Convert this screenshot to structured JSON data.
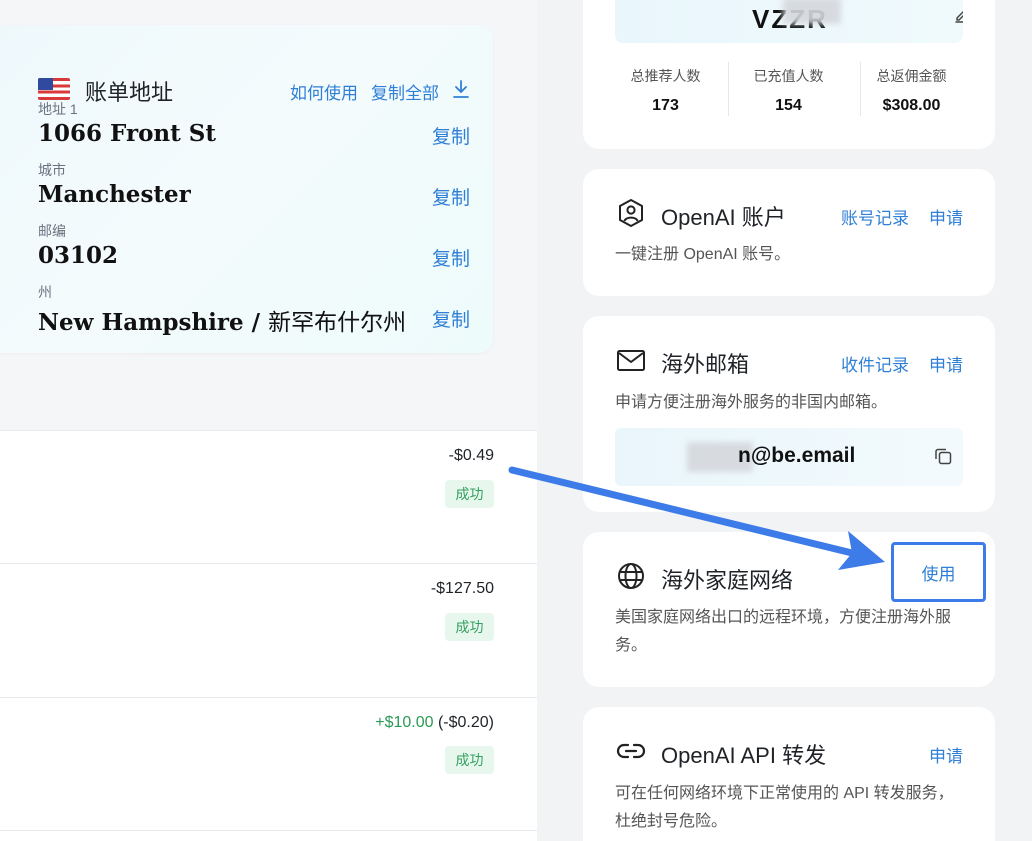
{
  "billing": {
    "title": "账单地址",
    "how_to_use": "如何使用",
    "copy_all": "复制全部",
    "copy_label": "复制",
    "fields": [
      {
        "label": "地址 1",
        "value": "1066 Front St"
      },
      {
        "label": "城市",
        "value": "Manchester"
      },
      {
        "label": "邮编",
        "value": "03102"
      },
      {
        "label": "州",
        "value": "New Hampshire / ",
        "value_cn": "新罕布什尔州"
      }
    ]
  },
  "transactions": [
    {
      "amount": "-$0.49",
      "status": "成功"
    },
    {
      "amount": "-$127.50",
      "status": "成功"
    },
    {
      "amount_positive": "+$10.00",
      "amount_fee": " (-$0.20)",
      "status": "成功"
    }
  ],
  "referral": {
    "banner_code": "VZZR",
    "stats": [
      {
        "label": "总推荐人数",
        "value": "173"
      },
      {
        "label": "已充值人数",
        "value": "154"
      },
      {
        "label": "总返佣金额",
        "value": "$308.00"
      }
    ]
  },
  "services": {
    "openai_account": {
      "title": "OpenAI 账户",
      "link_record": "账号记录",
      "link_apply": "申请",
      "desc": "一键注册 OpenAI 账号。"
    },
    "overseas_email": {
      "title": "海外邮箱",
      "link_record": "收件记录",
      "link_apply": "申请",
      "desc": "申请方便注册海外服务的非国内邮箱。",
      "email_suffix": "n@be.email"
    },
    "home_network": {
      "title": "海外家庭网络",
      "use_label": "使用",
      "desc": "美国家庭网络出口的远程环境，方便注册海外服务。"
    },
    "api_relay": {
      "title": "OpenAI API 转发",
      "link_apply": "申请",
      "desc": "可在任何网络环境下正常使用的 API 转发服务，杜绝封号危险。"
    }
  },
  "colors": {
    "accent": "#2f7fd6",
    "success_bg": "#e8f7ee",
    "success_text": "#35a15f",
    "annotation_arrow": "#3d7be8"
  }
}
